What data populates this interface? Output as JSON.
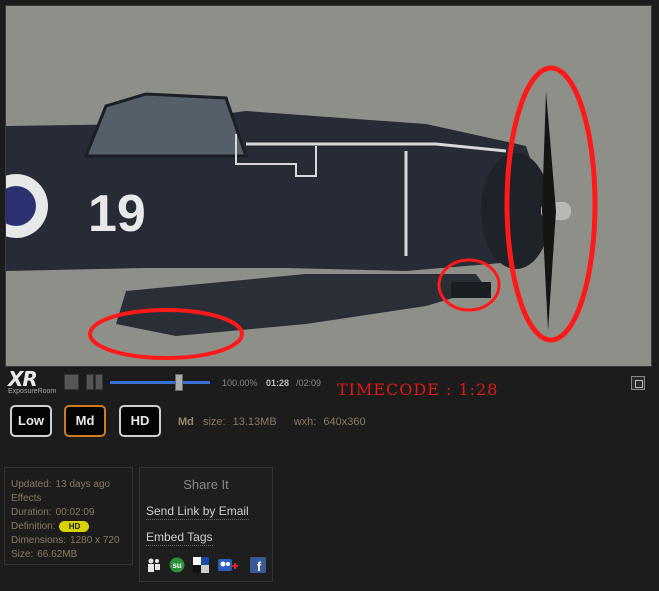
{
  "player": {
    "logo_text": "XR",
    "logo_subtext": "ExposureRoom",
    "aircraft_number": "19",
    "zoom": "100.00%",
    "current_time": "01:28",
    "total_time": "/02:09",
    "seek_progress": 0.68,
    "timecode_label": "TIMECODE : 1:28"
  },
  "quality": {
    "buttons": [
      {
        "label": "Low",
        "selected": false
      },
      {
        "label": "Md",
        "selected": true
      },
      {
        "label": "HD",
        "selected": false
      }
    ],
    "current_level": "Md",
    "size_label": "size:",
    "size_value": "13.13MB",
    "dims_label": "wxh:",
    "dims_value": "640x360"
  },
  "details": {
    "updated_label": "Updated:",
    "updated_value": "13 days ago",
    "effects_label": "Effects",
    "duration_label": "Duration:",
    "duration_value": "00:02:09",
    "definition_label": "Definition:",
    "definition_badge": "HD",
    "dimensions_label": "Dimensions:",
    "dimensions_value": "1280 x 720",
    "size_label": "Size:",
    "size_value": "66.62MB"
  },
  "share": {
    "title": "Share It",
    "email_link": "Send Link by Email",
    "embed_link": "Embed Tags",
    "icons": [
      "myspace-icon",
      "stumbleupon-icon",
      "delicious-icon",
      "digg-icon",
      "facebook-icon"
    ],
    "facebook_glyph": "f"
  },
  "colors": {
    "accent_selected": "#d07a22",
    "timecode": "#e01818",
    "seek_bar": "#3b6fd8",
    "annotation": "#ff1a1a"
  }
}
